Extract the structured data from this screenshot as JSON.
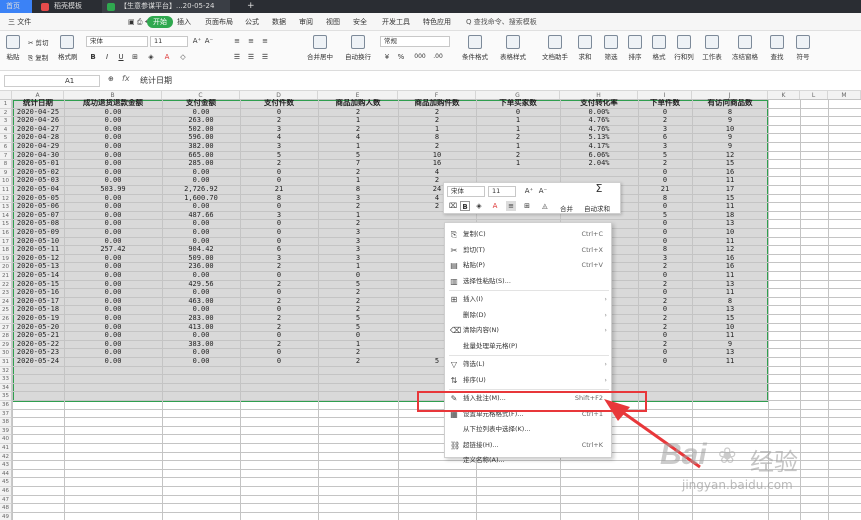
{
  "tabs": [
    {
      "label": "首页",
      "color": "#3b82f6"
    },
    {
      "label": "稻壳模板",
      "color": "#e54b4b"
    },
    {
      "label": "【生意参谋平台】...20-05-24",
      "color": "#2fa84f"
    }
  ],
  "new_tab": "+",
  "menus": [
    "三 文件",
    "开始",
    "插入",
    "页面布局",
    "公式",
    "数据",
    "审阅",
    "视图",
    "安全",
    "开发工具",
    "特色应用",
    "Q 查找命令、搜索模板"
  ],
  "active_menu": "开始",
  "ribbon": {
    "paste": "粘贴",
    "cut": "剪切",
    "copy": "复制",
    "format_painter": "格式刷",
    "font": "宋体",
    "size": "11",
    "number_format": "常规",
    "merge": "合并居中",
    "wrap": "自动换行",
    "buttons": [
      "条件格式",
      "表格样式",
      "文档助手",
      "求和",
      "筛选",
      "排序",
      "格式",
      "行和列",
      "工作表",
      "冻结窗格",
      "查找",
      "符号"
    ]
  },
  "formula": {
    "cellref": "A1",
    "fx": "fx",
    "value": "统计日期"
  },
  "columns": [
    "A",
    "B",
    "C",
    "D",
    "E",
    "F",
    "G",
    "H",
    "I",
    "J",
    "K",
    "L",
    "M"
  ],
  "headers": [
    "统计日期",
    "成功退货退款金额",
    "支付金额",
    "支付件数",
    "商品加购人数",
    "商品加购件数",
    "下单买家数",
    "支付转化率",
    "下单件数",
    "有访问商品数"
  ],
  "rows": [
    [
      "2020-04-25",
      "0.00",
      "0.00",
      "0",
      "2",
      "2",
      "0",
      "0.00%",
      "0",
      "8"
    ],
    [
      "2020-04-26",
      "0.00",
      "263.00",
      "2",
      "1",
      "2",
      "1",
      "4.76%",
      "2",
      "9"
    ],
    [
      "2020-04-27",
      "0.00",
      "502.00",
      "3",
      "2",
      "1",
      "1",
      "4.76%",
      "3",
      "10"
    ],
    [
      "2020-04-28",
      "0.00",
      "596.00",
      "4",
      "4",
      "8",
      "2",
      "5.13%",
      "6",
      "9"
    ],
    [
      "2020-04-29",
      "0.00",
      "382.00",
      "3",
      "1",
      "2",
      "1",
      "4.17%",
      "3",
      "9"
    ],
    [
      "2020-04-30",
      "0.00",
      "665.00",
      "5",
      "5",
      "10",
      "2",
      "6.06%",
      "5",
      "12"
    ],
    [
      "2020-05-01",
      "0.00",
      "285.00",
      "2",
      "7",
      "16",
      "1",
      "2.04%",
      "2",
      "15"
    ],
    [
      "2020-05-02",
      "0.00",
      "0.00",
      "0",
      "2",
      "4",
      "",
      "",
      "0",
      "16"
    ],
    [
      "2020-05-03",
      "0.00",
      "0.00",
      "0",
      "1",
      "2",
      "",
      "",
      "0",
      "11"
    ],
    [
      "2020-05-04",
      "503.99",
      "2,726.92",
      "21",
      "8",
      "24",
      "",
      "",
      "21",
      "17"
    ],
    [
      "2020-05-05",
      "0.00",
      "1,600.70",
      "8",
      "3",
      "4",
      "",
      "",
      "8",
      "15"
    ],
    [
      "2020-05-06",
      "0.00",
      "0.00",
      "0",
      "2",
      "2",
      "",
      "",
      "0",
      "11"
    ],
    [
      "2020-05-07",
      "0.00",
      "487.66",
      "3",
      "1",
      "",
      "",
      "",
      "5",
      "18"
    ],
    [
      "2020-05-08",
      "0.00",
      "0.00",
      "0",
      "2",
      "",
      "",
      "",
      "0",
      "13"
    ],
    [
      "2020-05-09",
      "0.00",
      "0.00",
      "0",
      "3",
      "",
      "",
      "",
      "0",
      "10"
    ],
    [
      "2020-05-10",
      "0.00",
      "0.00",
      "0",
      "3",
      "",
      "",
      "",
      "0",
      "11"
    ],
    [
      "2020-05-11",
      "257.42",
      "904.42",
      "6",
      "3",
      "",
      "",
      "",
      "8",
      "12"
    ],
    [
      "2020-05-12",
      "0.00",
      "509.00",
      "3",
      "3",
      "",
      "",
      "",
      "3",
      "16"
    ],
    [
      "2020-05-13",
      "0.00",
      "236.00",
      "2",
      "1",
      "",
      "",
      "",
      "2",
      "16"
    ],
    [
      "2020-05-14",
      "0.00",
      "0.00",
      "0",
      "0",
      "",
      "",
      "",
      "0",
      "11"
    ],
    [
      "2020-05-15",
      "0.00",
      "429.56",
      "2",
      "5",
      "",
      "",
      "",
      "2",
      "13"
    ],
    [
      "2020-05-16",
      "0.00",
      "0.00",
      "0",
      "2",
      "",
      "",
      "",
      "0",
      "11"
    ],
    [
      "2020-05-17",
      "0.00",
      "463.00",
      "2",
      "2",
      "",
      "",
      "",
      "2",
      "8"
    ],
    [
      "2020-05-18",
      "0.00",
      "0.00",
      "0",
      "2",
      "",
      "",
      "",
      "0",
      "13"
    ],
    [
      "2020-05-19",
      "0.00",
      "283.00",
      "2",
      "5",
      "",
      "",
      "",
      "2",
      "15"
    ],
    [
      "2020-05-20",
      "0.00",
      "413.00",
      "2",
      "5",
      "",
      "",
      "",
      "2",
      "10"
    ],
    [
      "2020-05-21",
      "0.00",
      "0.00",
      "0",
      "0",
      "",
      "",
      "",
      "0",
      "11"
    ],
    [
      "2020-05-22",
      "0.00",
      "383.00",
      "2",
      "1",
      "",
      "",
      "",
      "2",
      "9"
    ],
    [
      "2020-05-23",
      "0.00",
      "0.00",
      "0",
      "2",
      "",
      "",
      "",
      "0",
      "13"
    ],
    [
      "2020-05-24",
      "0.00",
      "0.00",
      "0",
      "2",
      "5",
      "",
      "",
      "0",
      "11"
    ]
  ],
  "mini_toolbar": {
    "font": "宋体",
    "size": "11",
    "merge": "合并",
    "autosum": "自动求和"
  },
  "context_menu": [
    {
      "icon": "⎘",
      "label": "复制(C)",
      "shortcut": "Ctrl+C"
    },
    {
      "icon": "✂",
      "label": "剪切(T)",
      "shortcut": "Ctrl+X"
    },
    {
      "icon": "▤",
      "label": "粘贴(P)",
      "shortcut": "Ctrl+V"
    },
    {
      "icon": "▥",
      "label": "选择性粘贴(S)...",
      "shortcut": ""
    },
    {
      "sep": true
    },
    {
      "icon": "⊞",
      "label": "插入(I)",
      "shortcut": "",
      "arrow": true
    },
    {
      "icon": "",
      "label": "删除(D)",
      "shortcut": "",
      "arrow": true
    },
    {
      "icon": "⌫",
      "label": "清除内容(N)",
      "shortcut": "",
      "arrow": true
    },
    {
      "icon": "",
      "label": "批量处理单元格(P)",
      "shortcut": ""
    },
    {
      "sep": true
    },
    {
      "icon": "▽",
      "label": "筛选(L)",
      "shortcut": "",
      "arrow": true
    },
    {
      "icon": "⇅",
      "label": "排序(U)",
      "shortcut": "",
      "arrow": true
    },
    {
      "sep": true
    },
    {
      "icon": "✎",
      "label": "插入批注(M)...",
      "shortcut": "Shift+F2"
    },
    {
      "icon": "▦",
      "label": "设置单元格格式(F)...",
      "shortcut": "Ctrl+1"
    },
    {
      "icon": "",
      "label": "从下拉列表中选择(K)...",
      "shortcut": ""
    },
    {
      "icon": "⛓",
      "label": "超链接(H)...",
      "shortcut": "Ctrl+K"
    },
    {
      "icon": "",
      "label": "定义名称(A)...",
      "shortcut": ""
    }
  ],
  "watermark": {
    "brand": "Bai",
    "brand_cn": "经验",
    "url": "jingyan.baidu.com"
  }
}
